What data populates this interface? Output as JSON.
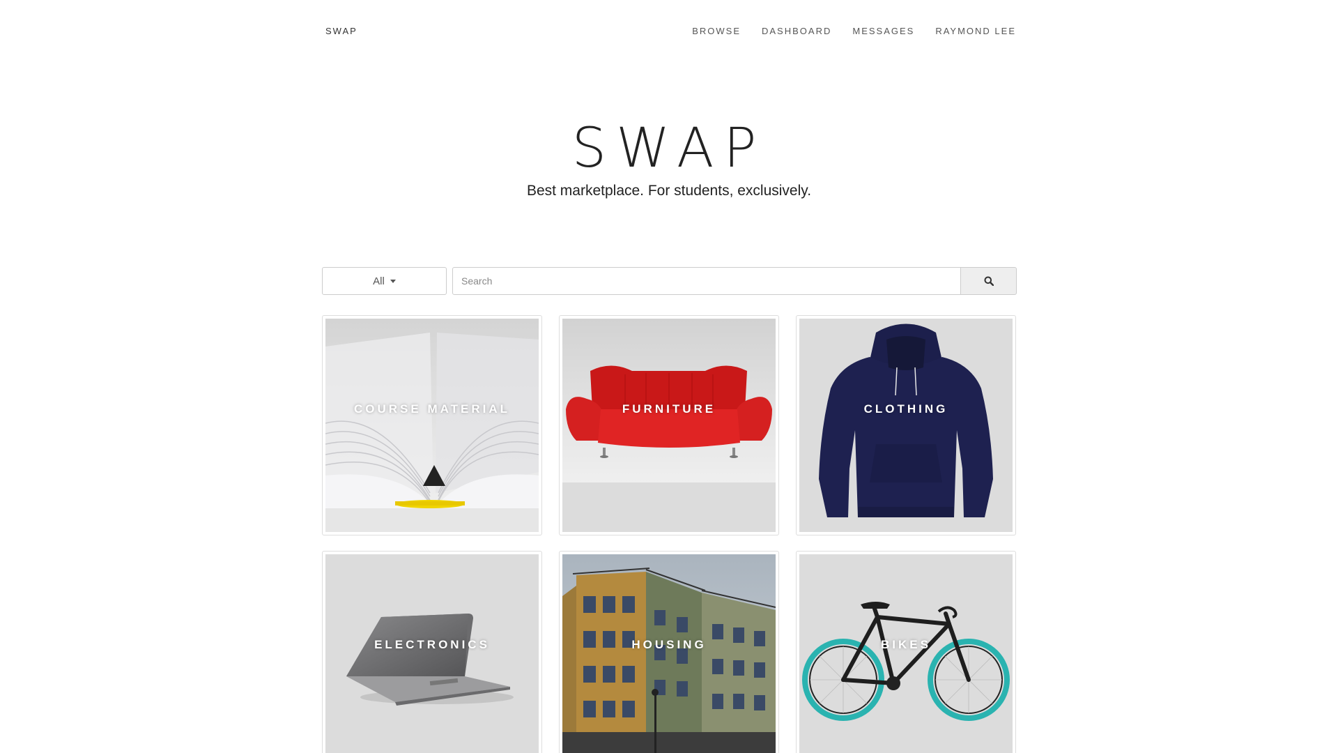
{
  "nav": {
    "brand": "SWAP",
    "links": [
      "BROWSE",
      "DASHBOARD",
      "MESSAGES",
      "RAYMOND LEE"
    ]
  },
  "hero": {
    "title": "SWAP",
    "tagline": "Best marketplace. For students, exclusively."
  },
  "search": {
    "category_selected": "All",
    "placeholder": "Search",
    "button_icon": "search-icon"
  },
  "categories": [
    {
      "label": "COURSE MATERIAL",
      "icon": "open-book-image"
    },
    {
      "label": "FURNITURE",
      "icon": "red-sofa-image"
    },
    {
      "label": "CLOTHING",
      "icon": "navy-hoodie-image"
    },
    {
      "label": "ELECTRONICS",
      "icon": "laptop-image"
    },
    {
      "label": "HOUSING",
      "icon": "apartment-building-image"
    },
    {
      "label": "BIKES",
      "icon": "bicycle-image"
    }
  ],
  "colors": {
    "background": "#ffffff",
    "card_border": "#dddddd",
    "card_bg": "#dcdcdc",
    "sofa": "#d61f1f",
    "hoodie": "#1e2150",
    "bike_wheel": "#2ab3b0"
  }
}
